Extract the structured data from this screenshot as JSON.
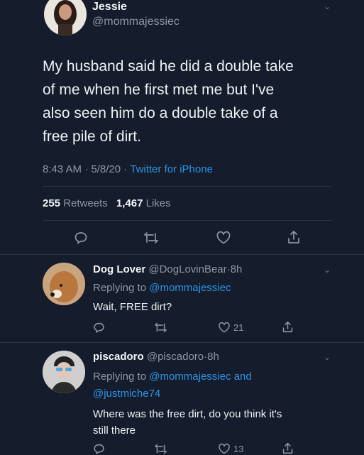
{
  "main_tweet": {
    "display_name": "Jessie",
    "handle": "@mommajessiec",
    "text_lines": [
      "My husband said he did a double take",
      "of me when he first met me but I've",
      "also seen him do a double take of a",
      "free pile of dirt."
    ],
    "time": "8:43 AM",
    "date": "5/8/20",
    "sep": "·",
    "source": "Twitter for iPhone",
    "retweets_count": "255",
    "retweets_label": "Retweets",
    "likes_count": "1,467",
    "likes_label": "Likes",
    "icons": [
      "reply-icon",
      "retweet-icon",
      "like-icon",
      "share-icon"
    ]
  },
  "replies": [
    {
      "display_name": "Dog Lover",
      "handle": "@DogLovinBear",
      "time": "8h",
      "replying_prefix": "Replying to",
      "replying_to": "@mommajessiec",
      "text": "Wait, FREE dirt?",
      "like_count": "21"
    },
    {
      "display_name": "piscadoro",
      "handle": "@piscadoro",
      "time": "8h",
      "replying_prefix": "Replying to",
      "replying_to": "@mommajessiec and",
      "replying_to_2": "@justmiche74",
      "text_lines": [
        "Where was the free dirt, do you think it's",
        "still there"
      ],
      "like_count": "13"
    }
  ],
  "colors": {
    "background": "#151c2b",
    "link": "#2b93e6",
    "muted": "#8b98a5"
  }
}
